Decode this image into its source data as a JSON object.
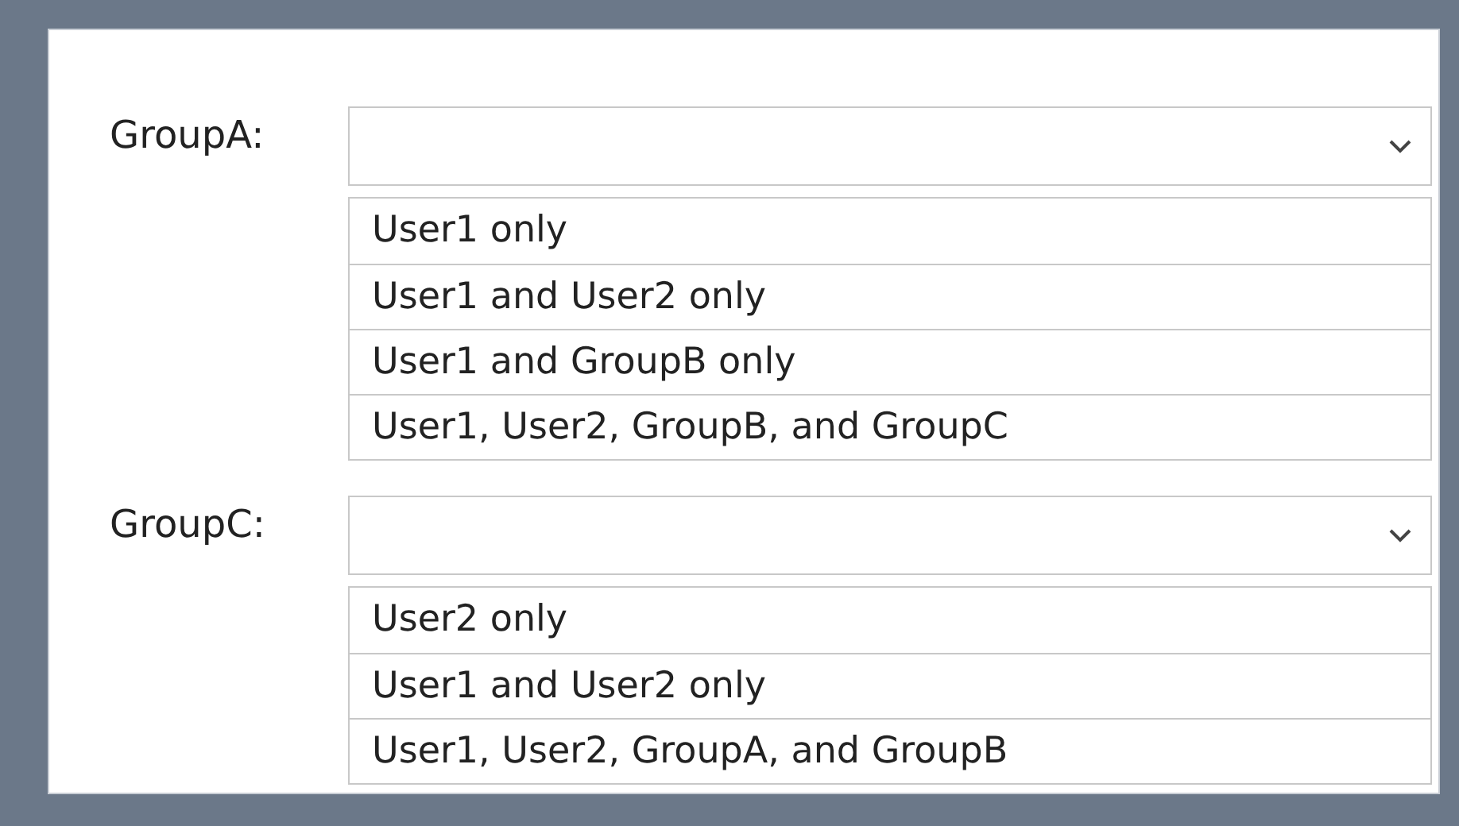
{
  "dropdowns": [
    {
      "label": "GroupA:",
      "options": [
        "User1 only",
        "User1 and User2 only",
        "User1 and GroupB only",
        "User1, User2, GroupB, and GroupC"
      ]
    },
    {
      "label": "GroupC:",
      "options": [
        "User2 only",
        "User1 and User2 only",
        "User1, User2, GroupA, and GroupB"
      ]
    }
  ]
}
